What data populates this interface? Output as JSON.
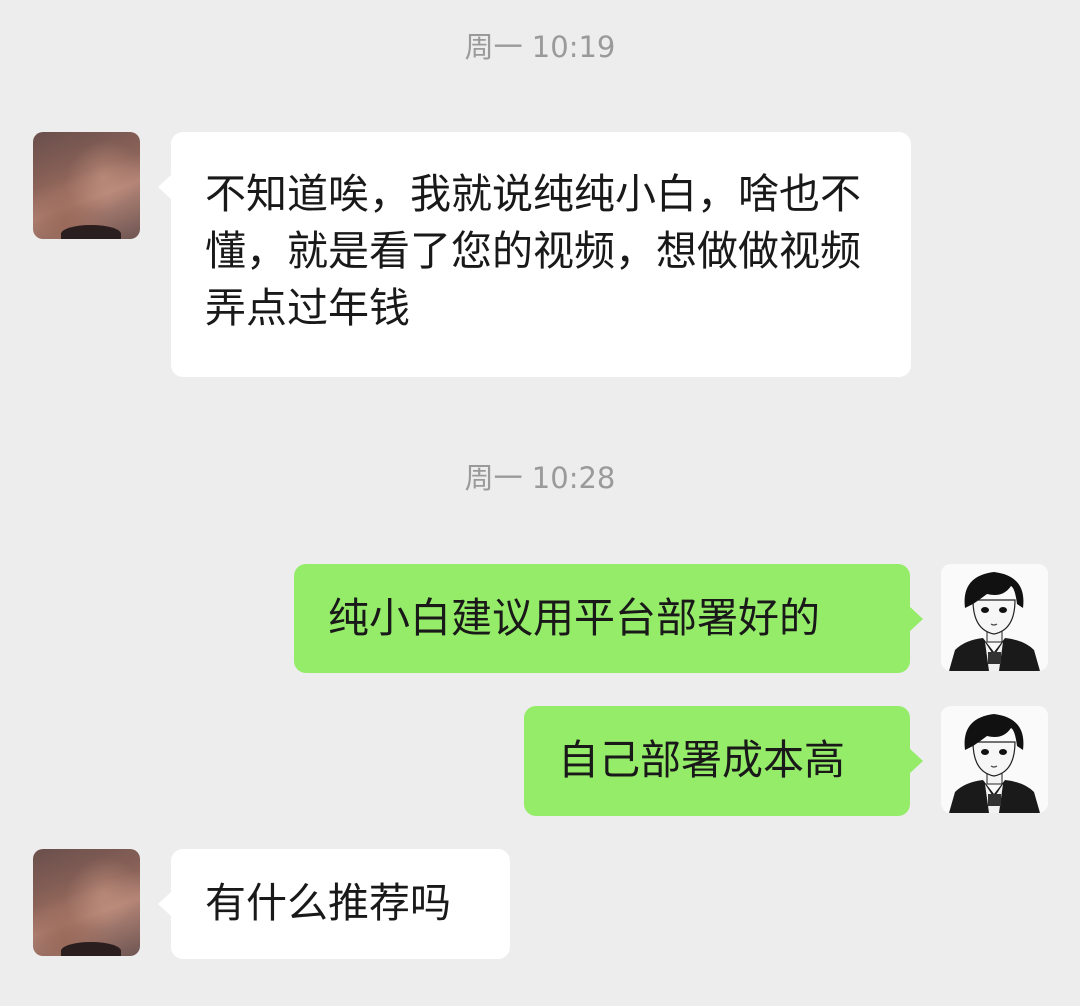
{
  "timestamps": [
    "周一 10:19",
    "周一 10:28"
  ],
  "messages": [
    {
      "sender": "contact",
      "text": "不知道唉，我就说纯纯小白，啥也不懂，就是看了您的视频，想做做视频弄点过年钱"
    },
    {
      "sender": "me",
      "text": "纯小白建议用平台部署好的"
    },
    {
      "sender": "me",
      "text": "自己部署成本高"
    },
    {
      "sender": "contact",
      "text": "有什么推荐吗"
    }
  ],
  "colors": {
    "background": "#ededed",
    "incoming_bubble": "#ffffff",
    "outgoing_bubble": "#95ec69",
    "timestamp_text": "#9a9a9a",
    "message_text": "#191919"
  }
}
